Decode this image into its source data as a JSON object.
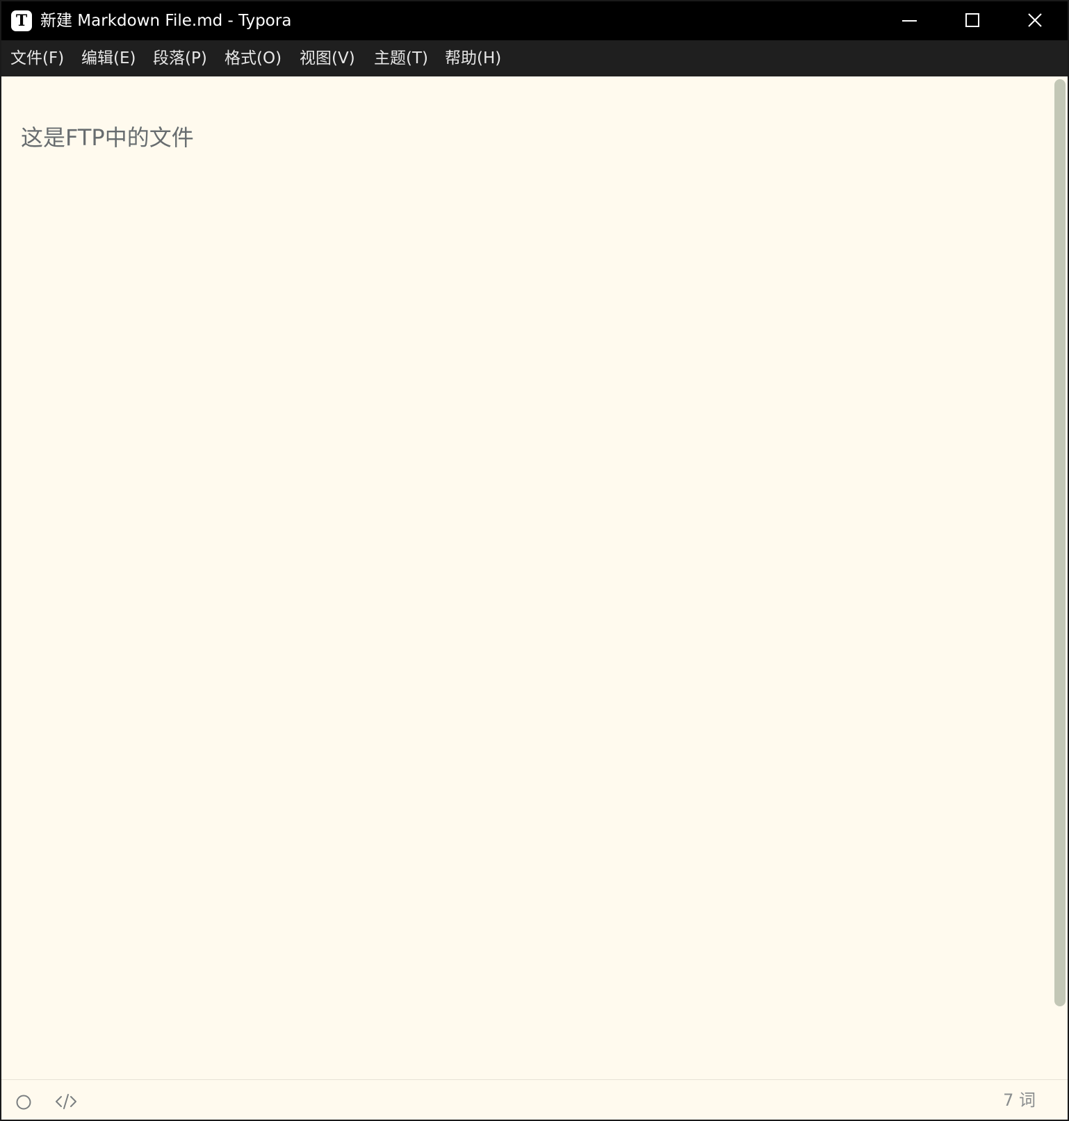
{
  "window": {
    "title": "新建 Markdown File.md - Typora",
    "app_icon_letter": "T",
    "controls": {
      "minimize_icon": "minimize-icon",
      "maximize_icon": "maximize-icon",
      "close_icon": "close-icon"
    }
  },
  "menu": {
    "items": [
      {
        "label": "文件(F)"
      },
      {
        "label": "编辑(E)"
      },
      {
        "label": "段落(P)"
      },
      {
        "label": "格式(O)"
      },
      {
        "label": "视图(V)"
      },
      {
        "label": "主题(T)"
      },
      {
        "label": "帮助(H)"
      }
    ]
  },
  "document": {
    "paragraphs": [
      {
        "text": "这是FTP中的文件"
      }
    ]
  },
  "statusbar": {
    "outline_icon": "circle-outline-icon",
    "source_icon": "code-brackets-icon",
    "word_count": "7 词"
  },
  "colors": {
    "titlebar_bg": "#000000",
    "menubar_bg": "#1f1f1f",
    "editor_bg": "#fffaee",
    "text": "#676c6f",
    "scrollbar": "#c3c7b6"
  }
}
